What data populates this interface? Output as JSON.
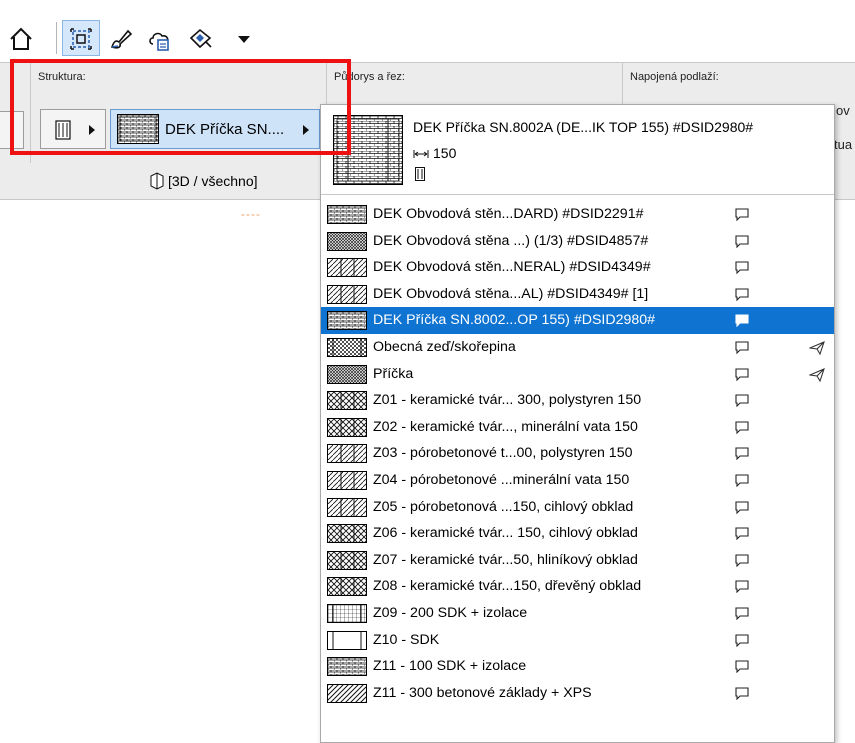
{
  "toolbar": {
    "icons": [
      "home-icon",
      "selection-frame-icon",
      "brush-icon",
      "cloud-doc-icon",
      "layer-diamond-icon",
      "dropdown-arrow-icon"
    ]
  },
  "infobar": {
    "struktura_label": "Struktura:",
    "pudorys_label": "Půdorys a řez:",
    "napojena_label": "Napojená podlaží:",
    "selected_structure": "DEK Příčka SN....",
    "edge_text_1": "ov",
    "edge_text_2": "tua"
  },
  "view_bar": {
    "view_label": "[3D / všechno]",
    "dashes": "----"
  },
  "dropdown": {
    "header": {
      "title": "DEK Příčka SN.8002A (DE...IK TOP 155) #DSID2980#",
      "thickness": "150"
    },
    "items": [
      {
        "label": "DEK Obvodová stěn...DARD) #DSID2291#",
        "pattern": "brick",
        "selected": false,
        "fav": false
      },
      {
        "label": "DEK Obvodová stěna ...) (1/3) #DSID4857#",
        "pattern": "dense",
        "selected": false,
        "fav": false
      },
      {
        "label": "DEK Obvodová stěn...NERAL) #DSID4349#",
        "pattern": "mixed",
        "selected": false,
        "fav": false
      },
      {
        "label": "DEK Obvodová stěna...AL) #DSID4349# [1]",
        "pattern": "mixed",
        "selected": false,
        "fav": false
      },
      {
        "label": "DEK Příčka SN.8002...OP 155) #DSID2980#",
        "pattern": "brick",
        "selected": true,
        "fav": false
      },
      {
        "label": "Obecná zeď/skořepina",
        "pattern": "shell",
        "selected": false,
        "fav": true
      },
      {
        "label": "Příčka",
        "pattern": "dense",
        "selected": false,
        "fav": true
      },
      {
        "label": "Z01 - keramické tvár... 300, polystyren 150",
        "pattern": "cross",
        "selected": false,
        "fav": false
      },
      {
        "label": "Z02 - keramické tvár..., minerální vata 150",
        "pattern": "cross",
        "selected": false,
        "fav": false
      },
      {
        "label": "Z03 - pórobetonové t...00, polystyren 150",
        "pattern": "mixed",
        "selected": false,
        "fav": false
      },
      {
        "label": "Z04 - pórobetonové ...minerální vata 150",
        "pattern": "mixed",
        "selected": false,
        "fav": false
      },
      {
        "label": "Z05 - pórobetonová ...150, cihlový obklad",
        "pattern": "mixed",
        "selected": false,
        "fav": false
      },
      {
        "label": "Z06 - keramické tvár... 150, cihlový obklad",
        "pattern": "cross",
        "selected": false,
        "fav": false
      },
      {
        "label": "Z07 - keramické tvár...50, hliníkový obklad",
        "pattern": "cross",
        "selected": false,
        "fav": false
      },
      {
        "label": "Z08 - keramické tvár...150, dřevěný obklad",
        "pattern": "cross",
        "selected": false,
        "fav": false
      },
      {
        "label": "Z09 - 200 SDK + izolace",
        "pattern": "sdk",
        "selected": false,
        "fav": false
      },
      {
        "label": "Z10 - SDK",
        "pattern": "empty",
        "selected": false,
        "fav": false
      },
      {
        "label": "Z11 - 100 SDK + izolace",
        "pattern": "brick",
        "selected": false,
        "fav": false
      },
      {
        "label": "Z11 - 300 betonové základy + XPS",
        "pattern": "hatch",
        "selected": false,
        "fav": false
      }
    ]
  },
  "colors": {
    "selected_row": "#0f73d1",
    "highlight_outline": "#ee1111",
    "active_tool_bg": "#d4e7fb",
    "structure_button_bg": "#cfe3f8"
  }
}
